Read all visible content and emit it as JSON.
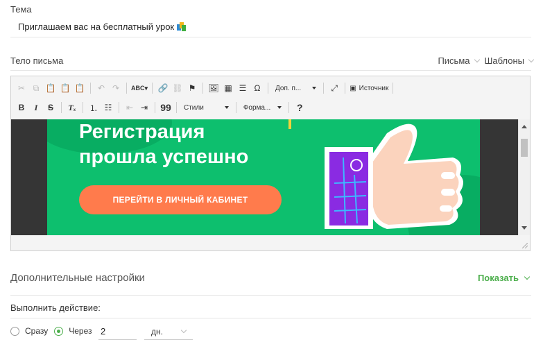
{
  "subject": {
    "label": "Тема",
    "value": "Приглашаем вас на бесплатный урок"
  },
  "body": {
    "label": "Тело письма",
    "letters_link": "Письма",
    "templates_link": "Шаблоны"
  },
  "toolbar": {
    "extra_combo": "Доп. п...",
    "source_label": "Источник",
    "styles_combo": "Стили",
    "format_combo": "Форма...",
    "bold": "B",
    "italic": "I",
    "strike": "S",
    "quote": "99",
    "help": "?"
  },
  "banner": {
    "title_line1": "Регистрация",
    "title_line2": "прошла успешно",
    "button_label": "ПЕРЕЙТИ В ЛИЧНЫЙ КАБИНЕТ",
    "bg_color": "#0dbf6e",
    "button_color": "#ff7b4c"
  },
  "advanced": {
    "title": "Дополнительные настройки",
    "toggle_label": "Показать"
  },
  "action": {
    "label": "Выполнить действие:",
    "option_immediately": "Сразу",
    "option_after": "Через",
    "selected": "Через",
    "delay_value": "2",
    "unit": "дн."
  },
  "colors": {
    "accent": "#4cae4c"
  }
}
